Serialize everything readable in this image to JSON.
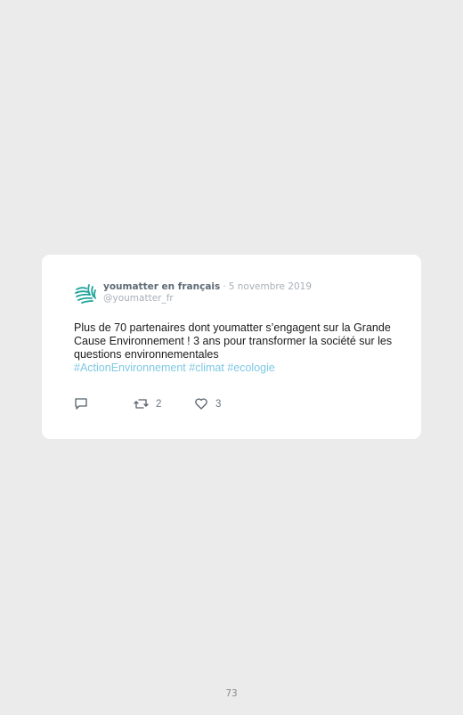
{
  "tweet": {
    "author_name": "youmatter en français",
    "separator": "·",
    "date": "5 novembre 2019",
    "handle": "@youmatter_fr",
    "text": "Plus de 70 partenaires dont youmatter s’engagent sur la Grande Cause Environnement ! 3 ans pour transformer la société sur les questions environnementales",
    "hashtags": "#ActionEnvironnement #climat #ecologie",
    "actions": {
      "reply": {
        "icon": "reply-icon",
        "count": ""
      },
      "retweet": {
        "icon": "retweet-icon",
        "count": "2"
      },
      "like": {
        "icon": "heart-icon",
        "count": "3"
      }
    },
    "avatar_icon": "youmatter-logo-icon"
  },
  "page": {
    "number": "73"
  },
  "colors": {
    "background": "#ebebeb",
    "card": "#ffffff",
    "hashtag": "#7ec8e3",
    "logo": "#1fa39a"
  }
}
